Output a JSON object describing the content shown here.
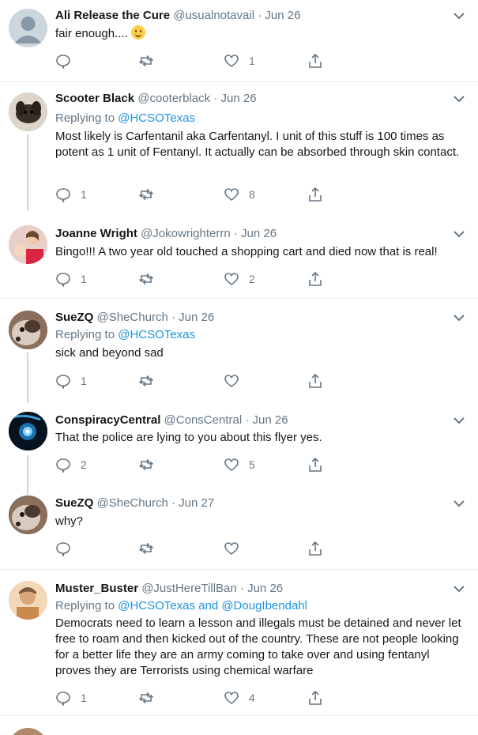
{
  "colors": {
    "link": "#1b95e0",
    "muted": "#657786",
    "border": "#e6ecf0",
    "thread": "#ccd6dd"
  },
  "tweets": [
    {
      "name": "Ali Release the Cure",
      "handle": "@usualnotavail",
      "dot": "·",
      "date": "Jun 26",
      "replying": "",
      "text": "fair enough....",
      "emoji": "slightly-smiling-face",
      "reply_count": "",
      "like_count": "1",
      "avatar": "default-avatar"
    },
    {
      "name": "Scooter Black",
      "handle": "@cooterblack",
      "dot": "·",
      "date": "Jun 26",
      "replying_prefix": "Replying to",
      "replying_to": "@HCSOTexas",
      "text": "Most likely is Carfentanil aka Carfentanyl. I unit of this stuff is 100 times as potent as 1 unit of Fentanyl. It actually can be absorbed through skin contact.",
      "reply_count": "1",
      "like_count": "8",
      "avatar": "dog-photo"
    },
    {
      "name": "Joanne Wright",
      "handle": "@Jokowrighterrn",
      "dot": "·",
      "date": "Jun 26",
      "text": "Bingo!!! A two year old touched a shopping cart and died now that is real!",
      "reply_count": "1",
      "like_count": "2",
      "avatar": "woman-with-child-photo"
    },
    {
      "name": "SueZQ",
      "handle": "@SheChurch",
      "dot": "·",
      "date": "Jun 26",
      "replying_prefix": "Replying to",
      "replying_to": "@HCSOTexas",
      "text": "sick and beyond sad",
      "reply_count": "1",
      "like_count": "",
      "avatar": "dog-closeup-photo"
    },
    {
      "name": "ConspiracyCentral",
      "handle": "@ConsCentral",
      "dot": "·",
      "date": "Jun 26",
      "text": "That the police are lying to you about this flyer yes.",
      "reply_count": "2",
      "like_count": "5",
      "avatar": "glowing-eye-image"
    },
    {
      "name": "SueZQ",
      "handle": "@SheChurch",
      "dot": "·",
      "date": "Jun 27",
      "text": "why?",
      "reply_count": "",
      "like_count": "",
      "avatar": "dog-closeup-photo"
    },
    {
      "name": "Muster_Buster",
      "handle": "@JustHereTillBan",
      "dot": "·",
      "date": "Jun 26",
      "replying_prefix": "Replying to",
      "replying_to": "@HCSOTexas and @DougIbendahl",
      "text": "Democrats need to learn a lesson and illegals must be detained and never let free to roam and then kicked out of the country. These are not people looking for a better life they are an army coming to take over and using fentanyl proves they are Terrorists using chemical warfare",
      "reply_count": "1",
      "like_count": "4",
      "avatar": "man-photo"
    }
  ]
}
